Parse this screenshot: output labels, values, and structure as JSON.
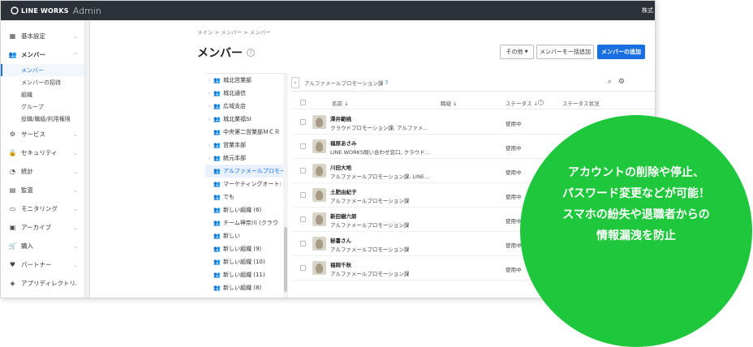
{
  "app": {
    "brand": "LINE WORKS",
    "suffix": "Admin",
    "top_right": "株式"
  },
  "sidebar": {
    "items": [
      {
        "label": "基本設定",
        "icon": "building-icon"
      },
      {
        "label": "メンバー",
        "icon": "people-icon",
        "expanded": true,
        "children": [
          "メンバー",
          "メンバーの招待",
          "組織",
          "グループ",
          "役職/職級/利用権限"
        ]
      },
      {
        "label": "サービス",
        "icon": "gear-icon"
      },
      {
        "label": "セキュリティ",
        "icon": "lock-icon"
      },
      {
        "label": "統計",
        "icon": "pie-chart-icon"
      },
      {
        "label": "監査",
        "icon": "document-icon"
      },
      {
        "label": "モニタリング",
        "icon": "monitor-icon"
      },
      {
        "label": "アーカイブ",
        "icon": "archive-icon"
      },
      {
        "label": "購入",
        "icon": "cart-icon"
      },
      {
        "label": "パートナー",
        "icon": "handshake-icon"
      },
      {
        "label": "アプリディレクトリ",
        "icon": "layers-icon"
      }
    ]
  },
  "breadcrumb": "メイン > メンバー > メンバー",
  "page_title": "メンバー",
  "help_glyph": "?",
  "buttons": {
    "other": "その他",
    "bulk_add": "メンバーを一括追加",
    "add": "メンバーの追加"
  },
  "tree": [
    {
      "label": "城北営業部",
      "arrow": true
    },
    {
      "label": "城北通信",
      "arrow": true
    },
    {
      "label": "広域支店",
      "arrow": true
    },
    {
      "label": "城北業福SI",
      "arrow": true
    },
    {
      "label": "中央第二営業部ＭＣＲ",
      "arrow": false
    },
    {
      "label": "営業本部",
      "arrow": true
    },
    {
      "label": "統元本部",
      "arrow": true
    },
    {
      "label": "アルファメールプロモー",
      "arrow": false,
      "selected": true
    },
    {
      "label": "マーケティングオート:",
      "arrow": false
    },
    {
      "label": "でも",
      "arrow": false
    },
    {
      "label": "新しい組織 (6)",
      "arrow": false
    },
    {
      "label": "チーム神奈川 (クラウ",
      "arrow": false
    },
    {
      "label": "新しい",
      "arrow": false
    },
    {
      "label": "新しい組織 (9)",
      "arrow": false
    },
    {
      "label": "新しい組織 (10)",
      "arrow": false
    },
    {
      "label": "新しい組織 (11)",
      "arrow": false
    },
    {
      "label": "新しい組織 (8)",
      "arrow": false
    }
  ],
  "list": {
    "group_name": "アルファメールプロモーション課",
    "group_count": "7",
    "columns": {
      "name": "名前 ↓",
      "title": "職級 ↓",
      "status": "ステータス ↓",
      "status_detail": "ステータス状況"
    },
    "rows": [
      {
        "name": "澤井範桃",
        "dept": "クラウドプロモーション課, アルファメ…",
        "status": "使用中"
      },
      {
        "name": "福原あさみ",
        "dept": "LINE WORKS問い合わせ窓口, クラウド…",
        "status": "使用中"
      },
      {
        "name": "川田大地",
        "dept": "アルファメールプロモーション課, LINE…",
        "status": "使用中"
      },
      {
        "name": "土肥由紀子",
        "dept": "アルファメールプロモーション課",
        "status": "使用中"
      },
      {
        "name": "新田樹六郎",
        "dept": "アルファメールプロモーション課",
        "status": "使用中"
      },
      {
        "name": "秘書さん",
        "dept": "アルファメールプロモーション課",
        "status": "使用中"
      },
      {
        "name": "福岡千秋",
        "dept": "アルファメールプロモーション課",
        "status": "使用中"
      }
    ]
  },
  "callout": {
    "lines": [
      "アカウントの削除や停止、",
      "パスワード変更などが可能！",
      "スマホの紛失や退職者からの",
      "情報漏洩を防止"
    ]
  },
  "colors": {
    "topbar": "#2d323a",
    "primary": "#1a6fe0",
    "callout": "#1ec73b"
  }
}
